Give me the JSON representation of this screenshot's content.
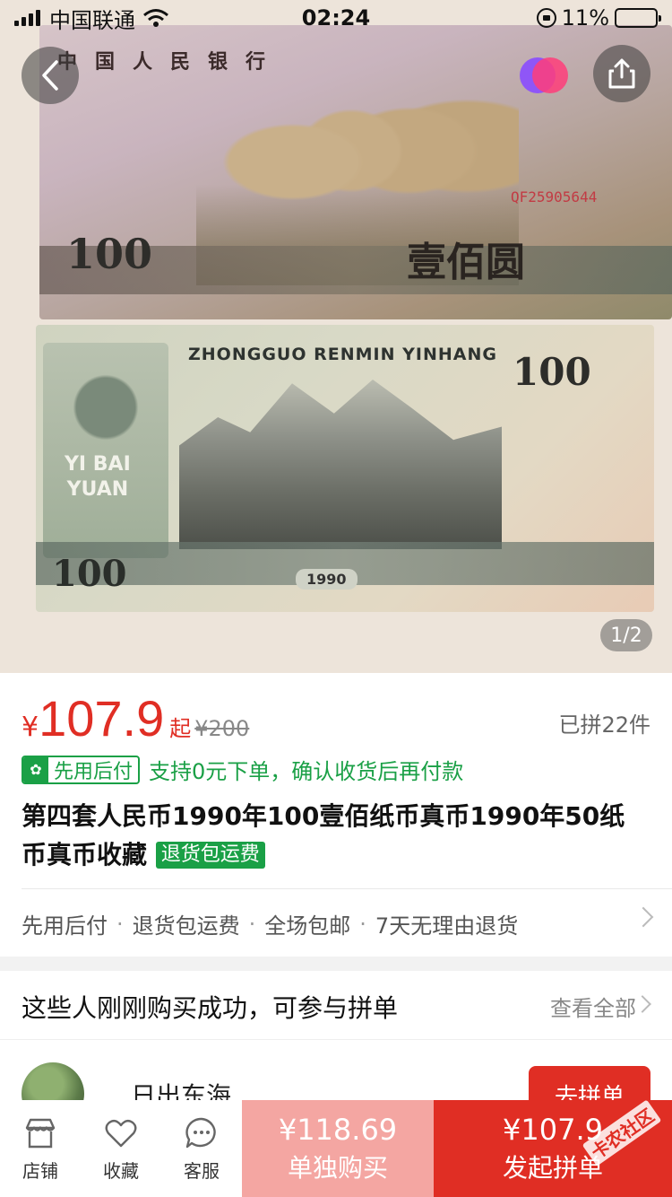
{
  "status_bar": {
    "carrier": "中国联通",
    "time": "02:24",
    "battery": "11%",
    "battery_level": 0.11
  },
  "hero": {
    "page_indicator": "1/2",
    "front_note": {
      "title": "中国人民银行",
      "denomination": "100",
      "denomination_cn": "壹佰圆",
      "serial": "QF25905644"
    },
    "back_note": {
      "heading": "ZHONGGUO RENMIN YINHANG",
      "denomination": "100",
      "yibai": "YI BAI",
      "yuan": "YUAN",
      "year": "1990"
    }
  },
  "product": {
    "currency": "¥",
    "price": "107.9",
    "price_suffix": "起",
    "original_price": "¥200",
    "sold": "已拼22件",
    "pay_later_badge": "先用后付",
    "pay_later_text": "支持0元下单，确认收货后再付款",
    "title": "第四套人民币1990年100壹佰纸币真币1990年50纸币真币收藏",
    "return_badge": "退货包运费",
    "services": [
      "先用后付",
      "退货包运费",
      "全场包邮",
      "7天无理由退货"
    ]
  },
  "group_buy": {
    "title": "这些人刚刚购买成功，可参与拼单",
    "view_all": "查看全部",
    "buyer_name": "日出东海",
    "join_label": "去拼单"
  },
  "bottom_bar": {
    "store": "店铺",
    "favorite": "收藏",
    "service": "客服",
    "single_price": "¥118.69",
    "single_label": "单独购买",
    "group_price": "¥107.9",
    "group_label": "发起拼单",
    "watermark": "卡农社区"
  },
  "colors": {
    "accent": "#e02e24",
    "green": "#1aa046",
    "single_btn": "#f4a6a2"
  }
}
